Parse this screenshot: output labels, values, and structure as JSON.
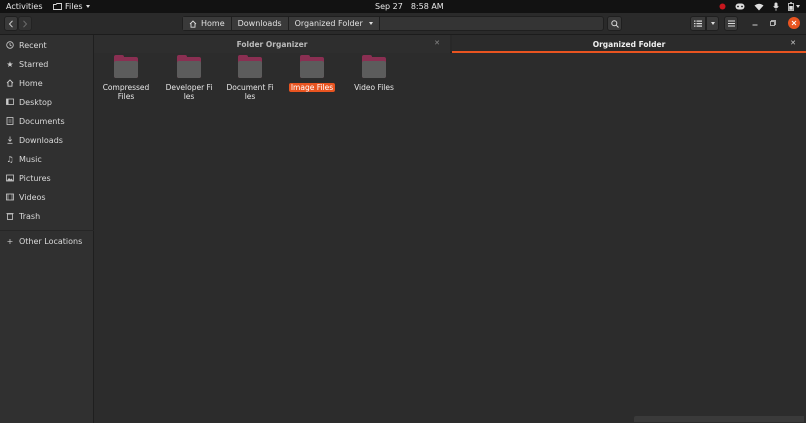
{
  "topbar": {
    "activities": "Activities",
    "app_name": "Files",
    "date": "Sep 27",
    "time": "8:58 AM"
  },
  "sidebar": {
    "items": [
      {
        "label": "Recent",
        "icon": "clock-icon"
      },
      {
        "label": "Starred",
        "icon": "star-icon"
      },
      {
        "label": "Home",
        "icon": "home-icon"
      },
      {
        "label": "Desktop",
        "icon": "desktop-icon"
      },
      {
        "label": "Documents",
        "icon": "document-icon"
      },
      {
        "label": "Downloads",
        "icon": "download-icon"
      },
      {
        "label": "Music",
        "icon": "music-icon"
      },
      {
        "label": "Pictures",
        "icon": "picture-icon"
      },
      {
        "label": "Videos",
        "icon": "video-icon"
      },
      {
        "label": "Trash",
        "icon": "trash-icon"
      },
      {
        "label": "Other Locations",
        "icon": "plus-icon"
      }
    ]
  },
  "pathbar": {
    "crumbs": [
      "Home",
      "Downloads",
      "Organized Folder"
    ]
  },
  "tabs": [
    {
      "label": "Folder Organizer",
      "active": false
    },
    {
      "label": "Organized Folder",
      "active": true
    }
  ],
  "files": [
    {
      "label": "Compressed Files",
      "selected": false
    },
    {
      "label": "Developer Files",
      "selected": false
    },
    {
      "label": "Document Files",
      "selected": false
    },
    {
      "label": "Image Files",
      "selected": true
    },
    {
      "label": "Video Files",
      "selected": false
    }
  ],
  "colors": {
    "accent": "#e95420",
    "folder_tab": "#8a2f52",
    "folder_body": "#5c5c5c",
    "background": "#2c2c2c"
  }
}
